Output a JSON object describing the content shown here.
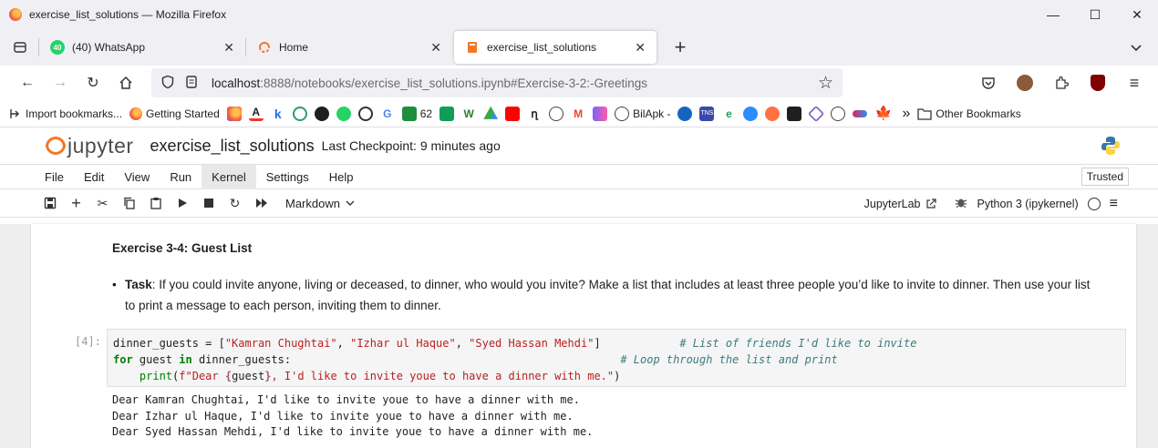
{
  "window": {
    "title": "exercise_list_solutions — Mozilla Firefox",
    "minimize": "—",
    "maximize": "☐",
    "close": "✕"
  },
  "tabs": [
    {
      "label": "(40) WhatsApp",
      "icon": "whatsapp-icon",
      "close": "✕",
      "badge": "40"
    },
    {
      "label": "Home",
      "icon": "jupyter-home-icon",
      "close": "✕"
    },
    {
      "label": "exercise_list_solutions",
      "icon": "notebook-icon",
      "close": "✕",
      "active": true
    }
  ],
  "tabs_extra": {
    "new_tab": "+",
    "list_all": "⌄"
  },
  "nav": {
    "back": "←",
    "forward": "→",
    "reload": "↻",
    "home": "⌂",
    "url_host": "localhost",
    "url_rest": ":8888/notebooks/exercise_list_solutions.ipynb#Exercise-3-2:-Greetings",
    "star": "☆",
    "menu": "≡"
  },
  "bookmarks": {
    "import": "Import bookmarks...",
    "getting_started": "Getting Started",
    "count_62": "62",
    "bilapk": "BilApk -",
    "overflow": "»",
    "other": "Other Bookmarks"
  },
  "jupyter": {
    "logo_text": "jupyter",
    "notebook_name": "exercise_list_solutions",
    "checkpoint": "Last Checkpoint: 9 minutes ago"
  },
  "menu": {
    "items": [
      "File",
      "Edit",
      "View",
      "Run",
      "Kernel",
      "Settings",
      "Help"
    ],
    "trusted": "Trusted"
  },
  "toolbar": {
    "cell_type": "Markdown",
    "jupyterlab": "JupyterLab",
    "kernel": "Python 3 (ipykernel)"
  },
  "notebook": {
    "heading": "Exercise 3-4: Guest List",
    "task_label": "Task",
    "task_text": ": If you could invite anyone, living or deceased, to dinner, who would you invite? Make a list that includes at least three people you’d like to invite to dinner. Then use your list to print a message to each person, inviting them to dinner.",
    "prompt": "[4]:",
    "output": [
      "Dear Kamran Chughtai, I'd like to invite youe to have a dinner with me.",
      "Dear Izhar ul Haque, I'd like to invite youe to have a dinner with me.",
      "Dear Syed Hassan Mehdi, I'd like to invite youe to have a dinner with me."
    ]
  }
}
